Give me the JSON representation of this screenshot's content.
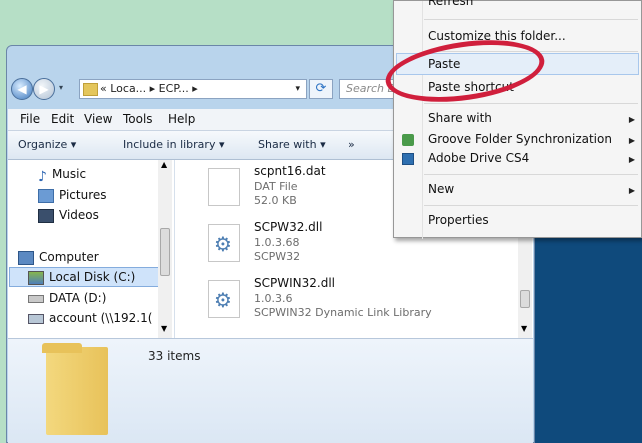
{
  "address": {
    "crumb": "« Loca... ▸ ECP... ▸",
    "search_placeholder": "Search ECPA"
  },
  "menubar": {
    "file": "File",
    "edit": "Edit",
    "view": "View",
    "tools": "Tools",
    "help": "Help"
  },
  "toolbar": {
    "organize": "Organize ▾",
    "include": "Include in library ▾",
    "share": "Share with ▾",
    "more": "»"
  },
  "nav_items": {
    "music": "Music",
    "pictures": "Pictures",
    "videos": "Videos",
    "computer": "Computer",
    "local_disk": "Local Disk (C:)",
    "data": "DATA (D:)",
    "account": "account (\\\\192.1("
  },
  "files": [
    {
      "name": "scpnt16.dat",
      "meta1": "DAT File",
      "meta2": "52.0 KB"
    },
    {
      "name": "SCPW32.dll",
      "meta1": "1.0.3.68",
      "meta2": "SCPW32"
    },
    {
      "name": "SCPWIN32.dll",
      "meta1": "1.0.3.6",
      "meta2": "SCPWIN32 Dynamic Link Library"
    }
  ],
  "details": {
    "count": "33 items"
  },
  "context_menu": {
    "refresh": "Refresh",
    "customize": "Customize this folder...",
    "paste": "Paste",
    "paste_shortcut": "Paste shortcut",
    "share_with": "Share with",
    "groove": "Groove Folder Synchronization",
    "adobe": "Adobe Drive CS4",
    "new": "New",
    "properties": "Properties"
  },
  "colors": {
    "desktop": "#0f4a7c",
    "highlight_circle": "#d01f3c",
    "background_green": "#b6dfc6"
  }
}
